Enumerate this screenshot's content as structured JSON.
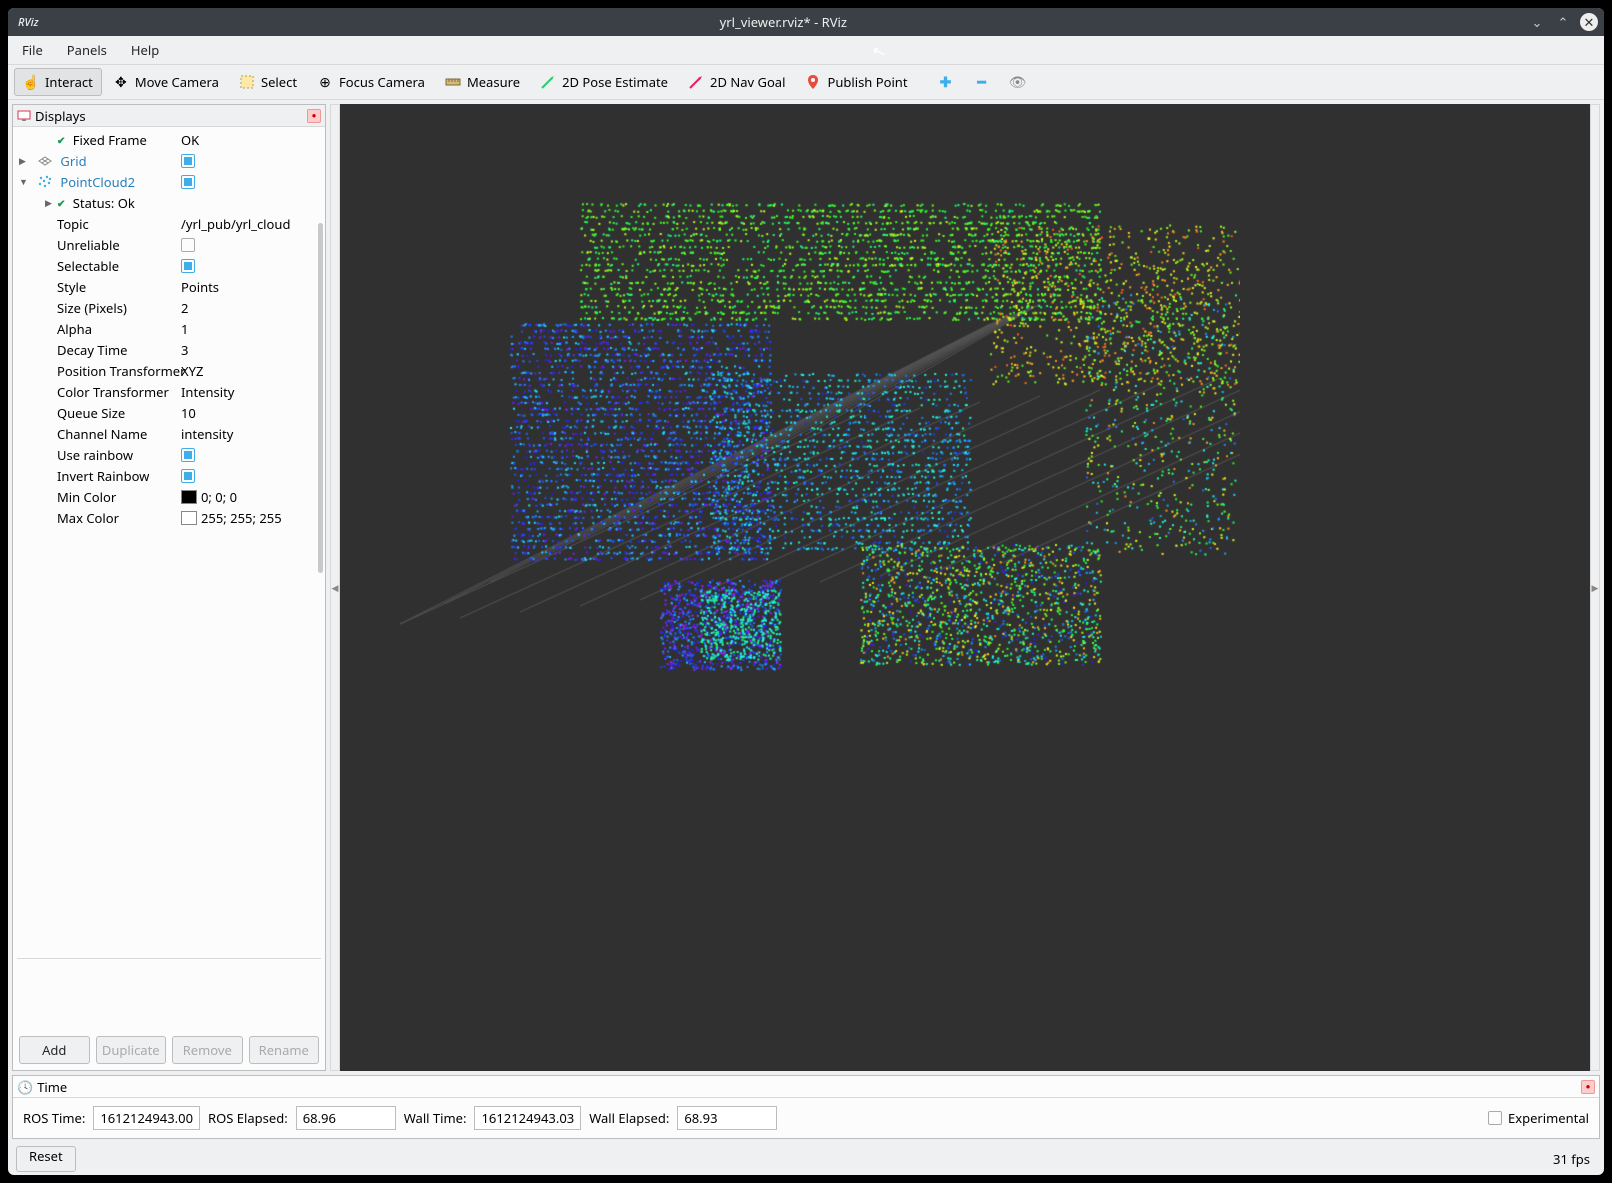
{
  "titlebar": {
    "app": "RViz",
    "title": "yrl_viewer.rviz* - RViz"
  },
  "menu": {
    "file": "File",
    "panels": "Panels",
    "help": "Help"
  },
  "toolbar": {
    "interact": "Interact",
    "move_camera": "Move Camera",
    "select": "Select",
    "focus_camera": "Focus Camera",
    "measure": "Measure",
    "pose_estimate": "2D Pose Estimate",
    "nav_goal": "2D Nav Goal",
    "publish_point": "Publish Point"
  },
  "displays_panel": {
    "title": "Displays",
    "fixed_frame": {
      "label": "Fixed Frame",
      "value": "OK"
    },
    "grid": {
      "label": "Grid"
    },
    "pointcloud": {
      "label": "PointCloud2"
    },
    "status": {
      "label": "Status: Ok"
    },
    "props": {
      "topic": {
        "label": "Topic",
        "value": "/yrl_pub/yrl_cloud"
      },
      "unreliable": {
        "label": "Unreliable"
      },
      "selectable": {
        "label": "Selectable"
      },
      "style": {
        "label": "Style",
        "value": "Points"
      },
      "size": {
        "label": "Size (Pixels)",
        "value": "2"
      },
      "alpha": {
        "label": "Alpha",
        "value": "1"
      },
      "decay": {
        "label": "Decay Time",
        "value": "3"
      },
      "pos_transform": {
        "label": "Position Transformer",
        "value": "XYZ"
      },
      "color_transform": {
        "label": "Color Transformer",
        "value": "Intensity"
      },
      "queue": {
        "label": "Queue Size",
        "value": "10"
      },
      "channel": {
        "label": "Channel Name",
        "value": "intensity"
      },
      "use_rainbow": {
        "label": "Use rainbow"
      },
      "invert_rainbow": {
        "label": "Invert Rainbow"
      },
      "min_color": {
        "label": "Min Color",
        "value": "0; 0; 0",
        "hex": "#000000"
      },
      "max_color": {
        "label": "Max Color",
        "value": "255; 255; 255",
        "hex": "#ffffff"
      }
    },
    "buttons": {
      "add": "Add",
      "duplicate": "Duplicate",
      "remove": "Remove",
      "rename": "Rename"
    }
  },
  "time_panel": {
    "title": "Time",
    "ros_time": {
      "label": "ROS Time:",
      "value": "1612124943.00"
    },
    "ros_elapsed": {
      "label": "ROS Elapsed:",
      "value": "68.96"
    },
    "wall_time": {
      "label": "Wall Time:",
      "value": "1612124943.03"
    },
    "wall_elapsed": {
      "label": "Wall Elapsed:",
      "value": "68.93"
    },
    "experimental": "Experimental"
  },
  "statusbar": {
    "reset": "Reset",
    "fps": "31 fps"
  }
}
